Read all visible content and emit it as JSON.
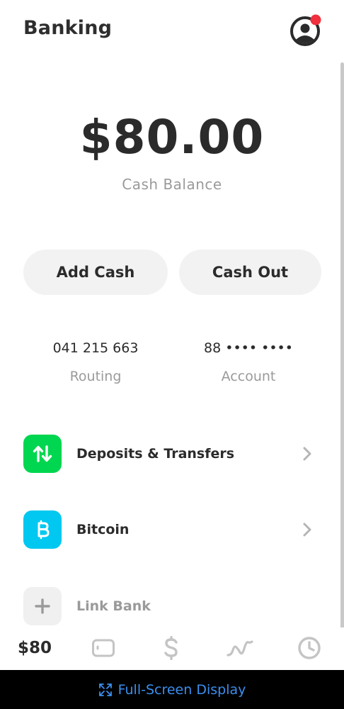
{
  "header": {
    "title": "Banking"
  },
  "balance": {
    "amount": "$80.00",
    "label": "Cash Balance"
  },
  "actions": {
    "add_cash": "Add Cash",
    "cash_out": "Cash Out"
  },
  "account_info": {
    "routing_number": "041 215 663",
    "routing_label": "Routing",
    "account_number": "88 •••• ••••",
    "account_label": "Account"
  },
  "list": [
    {
      "label": "Deposits & Transfers",
      "icon": "arrows-up-down-icon",
      "color": "#00d64f"
    },
    {
      "label": "Bitcoin",
      "icon": "bitcoin-icon",
      "color": "#00c8f0"
    },
    {
      "label": "Link Bank",
      "icon": "plus-icon",
      "color": "#f0f0f0"
    }
  ],
  "tabbar": {
    "balance_tab": "$80",
    "tabs": [
      "card-icon",
      "dollar-icon",
      "investing-icon",
      "activity-clock-icon"
    ]
  },
  "system_bar": {
    "label": "Full-Screen Display"
  },
  "colors": {
    "accent_green": "#00d64f",
    "bitcoin_blue": "#00c8f0",
    "notification_red": "#f0303c",
    "system_link_blue": "#3a8ff0"
  }
}
